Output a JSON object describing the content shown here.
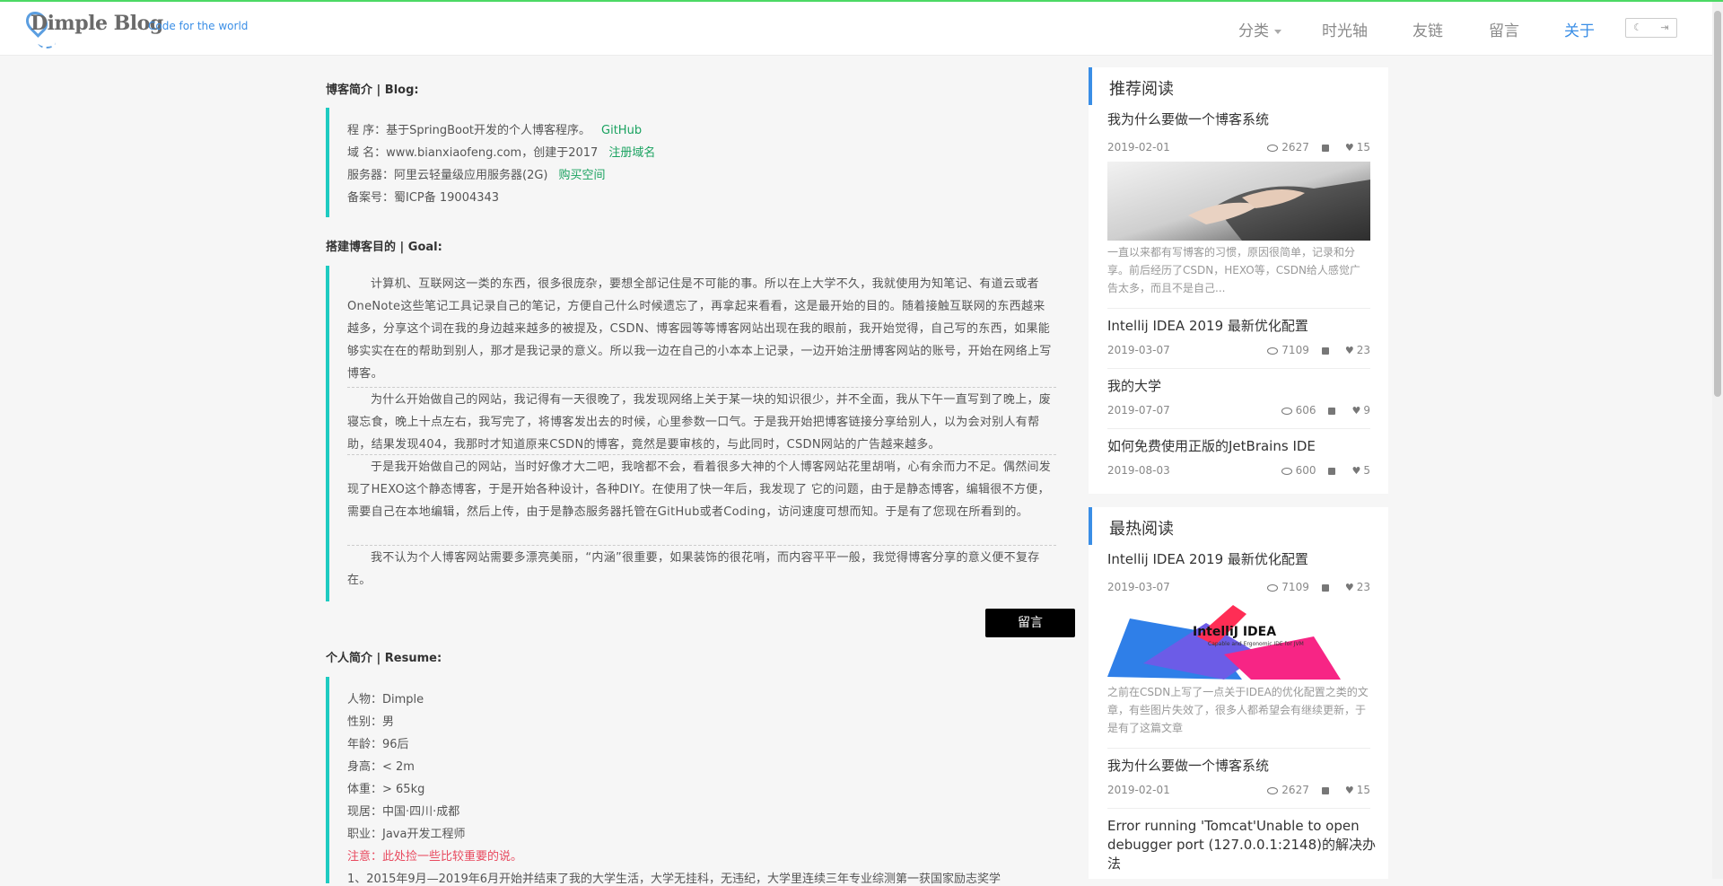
{
  "header": {
    "logo_text": "Dimple Blog",
    "tagline": "Code for the world",
    "nav": [
      {
        "label": "分类"
      },
      {
        "label": "时光轴"
      },
      {
        "label": "友链"
      },
      {
        "label": "留言"
      },
      {
        "label": "关于"
      }
    ]
  },
  "about": {
    "blog_title": "博客简介 | Blog:",
    "blog_lines": [
      {
        "text": "程 序：基于SpringBoot开发的个人博客程序。",
        "link": "GitHub"
      },
      {
        "text": "域 名：www.bianxiaofeng.com，创建于2017",
        "link": "注册域名"
      },
      {
        "text": "服务器：阿里云轻量级应用服务器(2G)",
        "link": "购买空间"
      },
      {
        "text": "备案号：蜀ICP备 19004343",
        "link": ""
      }
    ],
    "goal_title": "搭建博客目的 | Goal:",
    "goal_paras": [
      "计算机、互联网这一类的东西，很多很庞杂，要想全部记住是不可能的事。所以在上大学不久，我就使用为知笔记、有道云或者OneNote这些笔记工具记录自己的笔记，方便自己什么时候遗忘了，再拿起来看看，这是最开始的目的。随着接触互联网的东西越来越多，分享这个词在我的身边越来越多的被提及，CSDN、博客园等等博客网站出现在我的眼前，我开始觉得，自己写的东西，如果能够实实在在的帮助到别人，那才是我记录的意义。所以我一边在自己的小本本上记录，一边开始注册博客网站的账号，开始在网络上写博客。",
      "为什么开始做自己的网站，我记得有一天很晚了，我发现网络上关于某一块的知识很少，并不全面，我从下午一直写到了晚上，废寝忘食，晚上十点左右，我写完了，将博客发出去的时候，心里参数一口气。于是我开始把博客链接分享给别人，以为会对别人有帮助，结果发现404，我那时才知道原来CSDN的博客，竟然是要审核的，与此同时，CSDN网站的广告越来越多。",
      "于是我开始做自己的网站，当时好像才大二吧，我啥都不会，看着很多大神的个人博客网站花里胡哨，心有余而力不足。偶然间发现了HEXO这个静态博客，于是开始各种设计，各种DIY。在使用了快一年后，我发现了 它的问题，由于是静态博客，编辑很不方便，需要自己在本地编辑，然后上传，由于是静态服务器托管在GitHub或者Coding，访问速度可想而知。于是有了您现在所看到的。",
      "我不认为个人博客网站需要多漂亮美丽，“内涵”很重要，如果装饰的很花哨，而内容平平一般，我觉得博客分享的意义便不复存在。"
    ],
    "message_button": "留言",
    "resume_title": "个人简介 | Resume:",
    "resume_lines": [
      "人物：Dimple",
      "性别：男",
      "年龄：96后",
      "身高：< 2m",
      "体重：> 65kg",
      "现居：中国·四川·成都",
      "职业：Java开发工程师"
    ],
    "resume_note": "注意：此处捡一些比较重要的说。",
    "resume_item1": "1、2015年9月—2019年6月开始并结束了我的大学生活，大学无挂科，无违纪，大学里连续三年专业综测第一获国家励志奖学"
  },
  "recommend": {
    "title": "推荐阅读",
    "items": [
      {
        "title": "我为什么要做一个博客系统",
        "date": "2019-02-01",
        "views": "2627",
        "likes": "15",
        "desc": "一直以来都有写博客的习惯，原因很简单，记录和分享。前后经历了CSDN，HEXO等，CSDN给人感觉广告太多，而且不是自己..."
      },
      {
        "title": "Intellij IDEA 2019 最新优化配置",
        "date": "2019-03-07",
        "views": "7109",
        "likes": "23"
      },
      {
        "title": "我的大学",
        "date": "2019-07-07",
        "views": "606",
        "likes": "9"
      },
      {
        "title": "如何免费使用正版的JetBrains IDE",
        "date": "2019-08-03",
        "views": "600",
        "likes": "5"
      }
    ]
  },
  "hot": {
    "title": "最热阅读",
    "items": [
      {
        "title": "Intellij IDEA 2019 最新优化配置",
        "date": "2019-03-07",
        "views": "7109",
        "likes": "23",
        "desc": "之前在CSDN上写了一点关于IDEA的优化配置之类的文章，有些图片失效了，很多人都希望会有继续更新，于是有了这篇文章",
        "img_text": "IntelliJ IDEA",
        "img_sub": "Capable and Ergonomic IDE for JVM"
      },
      {
        "title": "我为什么要做一个博客系统",
        "date": "2019-02-01",
        "views": "2627",
        "likes": "15"
      },
      {
        "title": "Error running 'Tomcat'Unable to open debugger port (127.0.0.1:2148)的解决办法",
        "date": "",
        "views": "",
        "likes": ""
      }
    ]
  }
}
